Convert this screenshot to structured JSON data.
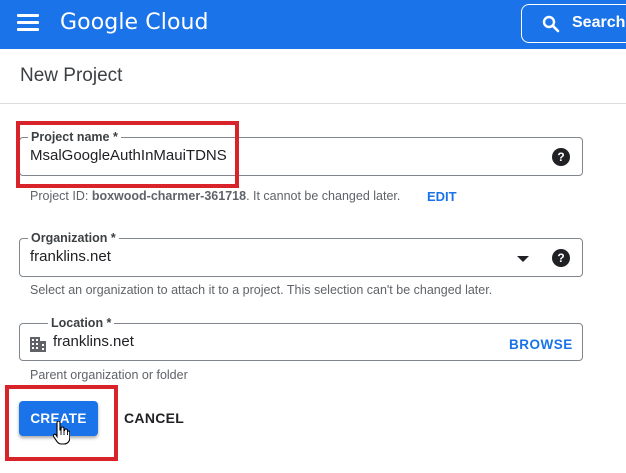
{
  "header": {
    "brand": "Google Cloud",
    "search_label": "Search",
    "menu_icon": "hamburger-menu-icon",
    "search_icon": "search-icon"
  },
  "page": {
    "title": "New Project"
  },
  "project_name": {
    "label": "Project name *",
    "value": "MsalGoogleAuthInMauiTDNS",
    "hint_prefix": "Project ID: ",
    "project_id": "boxwood-charmer-361718",
    "hint_suffix": ". It cannot be changed later.",
    "edit_label": "EDIT"
  },
  "organization": {
    "label": "Organization *",
    "value": "franklins.net",
    "hint": "Select an organization to attach it to a project. This selection can't be changed later."
  },
  "location": {
    "label": "Location *",
    "value": "franklins.net",
    "browse_label": "BROWSE",
    "hint": "Parent organization or folder"
  },
  "actions": {
    "create_label": "CREATE",
    "cancel_label": "CANCEL"
  },
  "colors": {
    "brand_blue": "#1a73e8",
    "annotation_red": "#d9232a"
  }
}
